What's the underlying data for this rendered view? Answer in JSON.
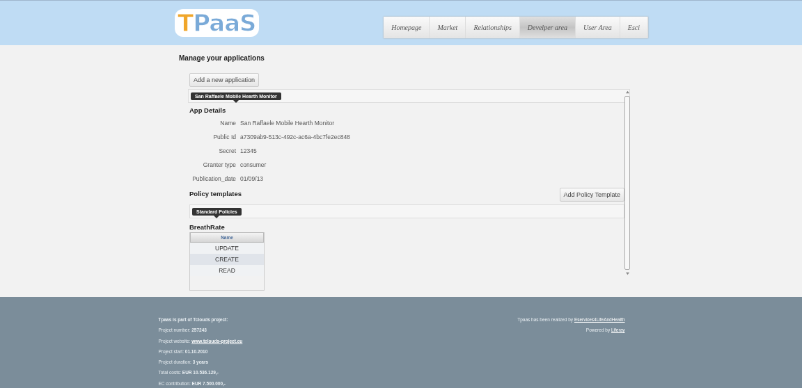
{
  "logo": {
    "first": "T",
    "rest": "PaaS"
  },
  "nav": [
    {
      "label": "Homepage",
      "selected": false
    },
    {
      "label": "Market",
      "selected": false
    },
    {
      "label": "Relationships",
      "selected": false
    },
    {
      "label": "Develper area",
      "selected": true
    },
    {
      "label": "User Area",
      "selected": false
    },
    {
      "label": "Esci",
      "selected": false
    }
  ],
  "page_title": "Manage your applications",
  "add_button": "Add a new application",
  "app_tab": "San Raffaele Mobile Hearth Monitor",
  "details_title": "App Details",
  "details": [
    {
      "label": "Name",
      "value": "San Raffaele Mobile Hearth Monitor"
    },
    {
      "label": "Public Id",
      "value": "a7309ab9-513c-492c-ac6a-4bc7fe2ec848"
    },
    {
      "label": "Secret",
      "value": "12345"
    },
    {
      "label": "Granter type",
      "value": "consumer"
    },
    {
      "label": "Publication_date",
      "value": "01/09/13"
    }
  ],
  "policy_title": "Policy templates",
  "add_policy_button": "Add Policy Template",
  "policy_tab": "Standard Policies",
  "policy_name": "BreathRate",
  "table": {
    "columns": [
      "Name"
    ],
    "rows": [
      {
        "cells": [
          "UPDATE"
        ],
        "selected": false
      },
      {
        "cells": [
          "CREATE"
        ],
        "selected": true
      },
      {
        "cells": [
          "READ"
        ],
        "selected": false
      }
    ]
  },
  "footer": {
    "left": [
      {
        "kind": "heading",
        "label": "Tpaas is part of Tclouds project:"
      },
      {
        "kind": "value",
        "label": "Project number:",
        "value": "257243"
      },
      {
        "kind": "link",
        "label": "Project website:",
        "value": "www.tclouds-project.eu"
      },
      {
        "kind": "value",
        "label": "Project start:",
        "value": "01.10.2010"
      },
      {
        "kind": "value",
        "label": "Project duration:",
        "value": "3 years"
      },
      {
        "kind": "value",
        "label": "Total costs:",
        "value": "EUR 10.536.129,-"
      },
      {
        "kind": "value",
        "label": "EC contribution:",
        "value": "EUR 7.500.000,-"
      }
    ],
    "right": [
      {
        "label": "Tpaas has been realized by",
        "link": "Eservices4LifeAndHealth"
      },
      {
        "label": "Powered by",
        "link": "Liferay"
      }
    ]
  }
}
